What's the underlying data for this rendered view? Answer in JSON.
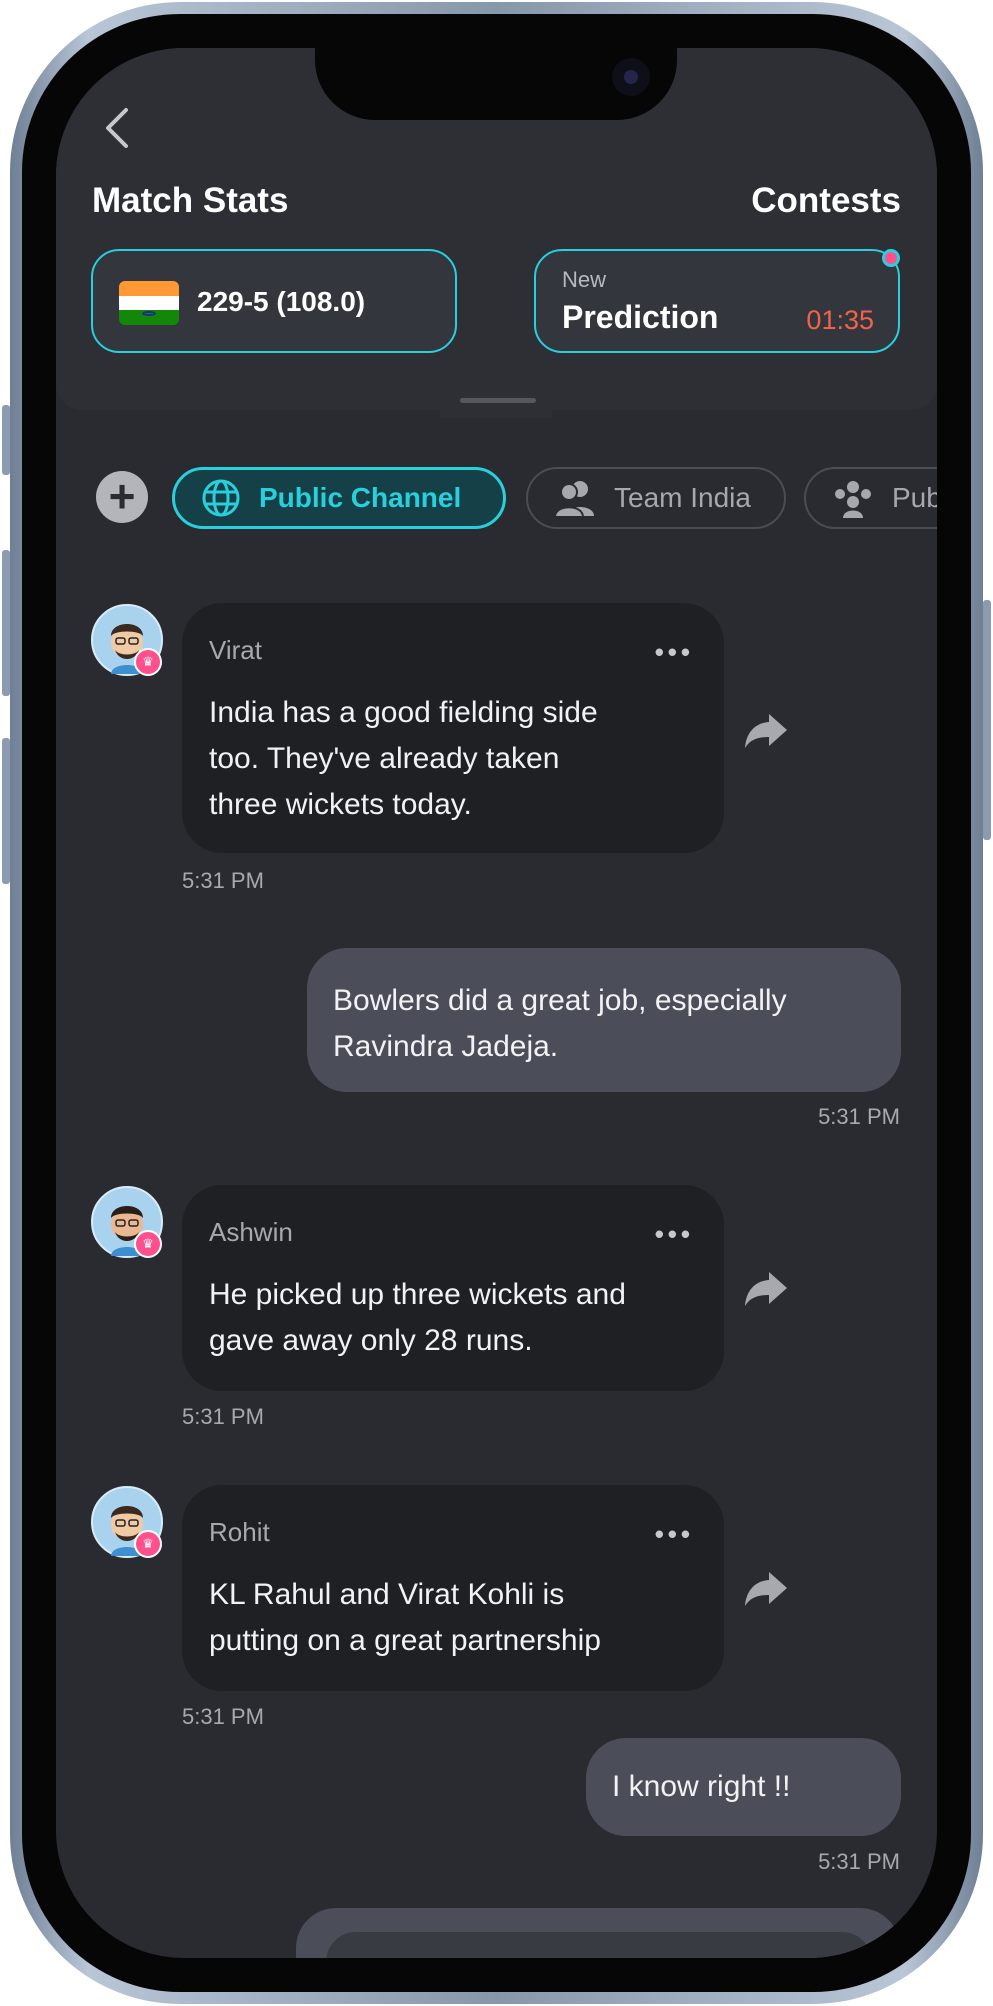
{
  "header": {
    "back_icon": "chevron-left-icon",
    "match_stats_title": "Match Stats",
    "contests_title": "Contests",
    "score": "229-5 (108.0)",
    "flag_icon": "india-flag-icon",
    "prediction_new": "New",
    "prediction_title": "Prediction",
    "prediction_timer": "01:35"
  },
  "channels": {
    "add_icon": "plus-icon",
    "items": [
      {
        "label": "Public Channel",
        "icon": "globe-icon",
        "active": true
      },
      {
        "label": "Team India",
        "icon": "people-icon",
        "active": false
      },
      {
        "label": "Pub",
        "icon": "group-icon",
        "active": false
      }
    ]
  },
  "messages": [
    {
      "type": "in",
      "sender": "Virat",
      "lines": [
        "India has a good fielding side",
        "too. They've already taken",
        "three wickets today."
      ],
      "time": "5:31 PM"
    },
    {
      "type": "out",
      "lines": [
        "Bowlers did a great job, especially",
        "Ravindra Jadeja."
      ],
      "time": "5:31 PM"
    },
    {
      "type": "in",
      "sender": "Ashwin",
      "lines": [
        "He picked up three wickets and",
        "gave away only 28 runs."
      ],
      "time": "5:31 PM"
    },
    {
      "type": "in",
      "sender": "Rohit",
      "lines": [
        "KL Rahul and Virat Kohli is",
        "putting on a great partnership"
      ],
      "time": "5:31 PM"
    },
    {
      "type": "out",
      "lines": [
        "I know right !!"
      ],
      "time": "5:31 PM"
    }
  ],
  "colors": {
    "accent": "#27d0dc",
    "timer": "#f2634a",
    "badge": "#ff4f8c",
    "background": "#292b31"
  }
}
